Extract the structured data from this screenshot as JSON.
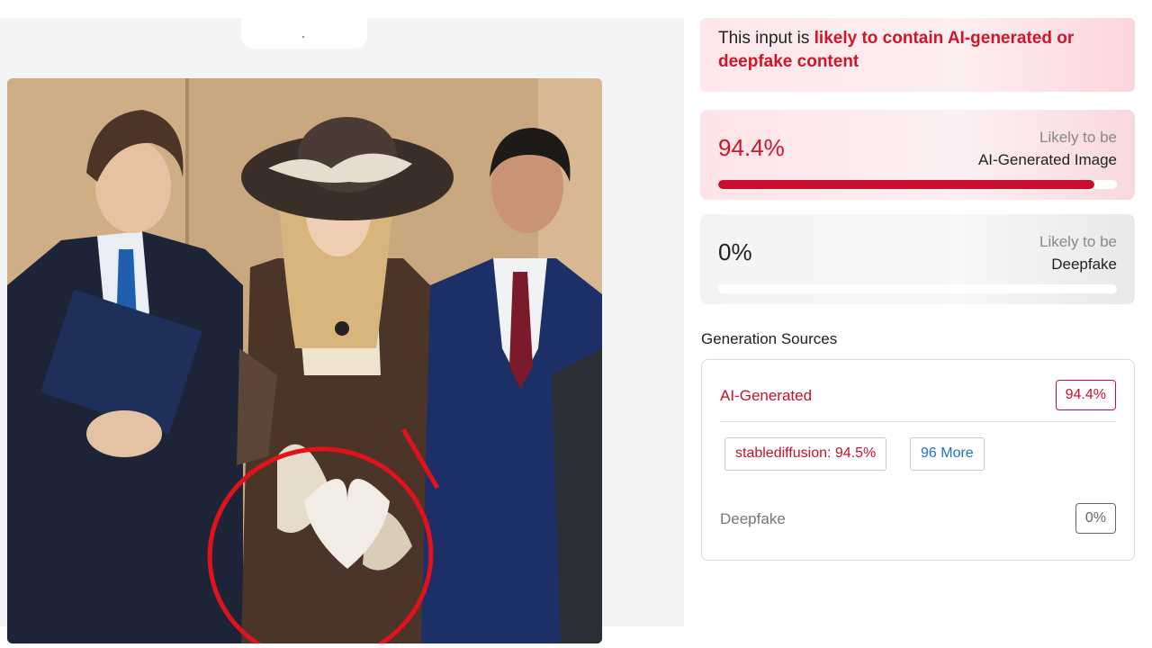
{
  "banner": {
    "prefix": "This input is ",
    "highlight": "likely to contain AI-generated or deepfake content"
  },
  "ai_card": {
    "percent": "94.4%",
    "label_line1": "Likely to be",
    "label_line2": "AI-Generated Image",
    "progress": 0.944
  },
  "deepfake_card": {
    "percent": "0%",
    "label_line1": "Likely to be",
    "label_line2": "Deepfake",
    "progress": 0
  },
  "sources": {
    "title": "Generation Sources",
    "ai_generated": {
      "label": "AI-Generated",
      "value": "94.4%"
    },
    "chips": [
      "stablediffusion: 94.5%",
      "96 More"
    ],
    "deepfake": {
      "label": "Deepfake",
      "value": "0%"
    }
  },
  "colors": {
    "accent_red": "#c8102e",
    "link_blue": "#1f6fd6"
  }
}
